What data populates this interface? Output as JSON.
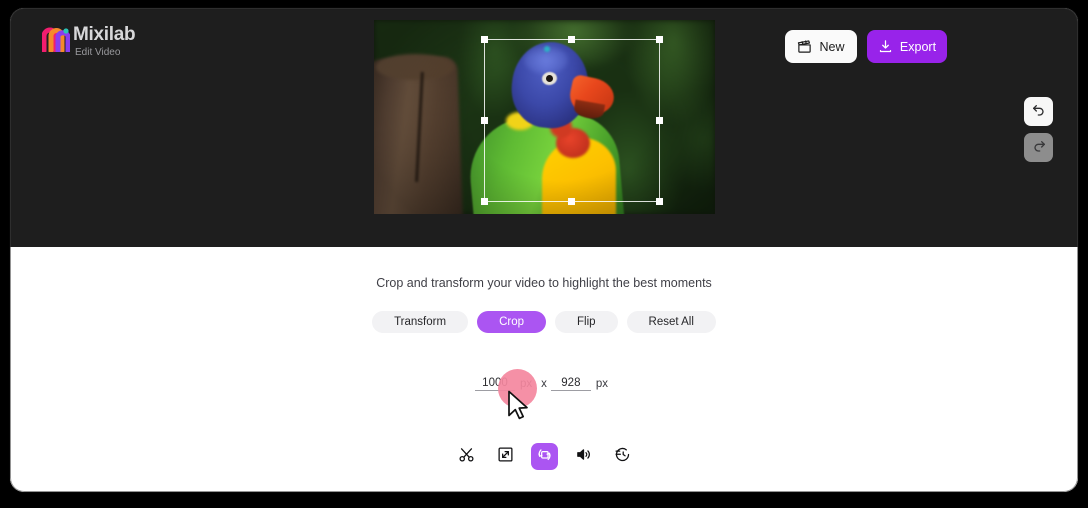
{
  "app": {
    "brand_name": "Mixilab",
    "brand_subtitle": "Edit Video",
    "accent_purple": "#ab55f2",
    "export_purple": "#9823ea",
    "header_bg": "#1e1e1e",
    "panel_bg": "#ffffff",
    "click_highlight_color": "#f4879e"
  },
  "header": {
    "new_label": "New",
    "new_icon": "clapperboard-icon",
    "export_label": "Export",
    "export_icon": "download-icon",
    "undo_icon": "undo-arrow-icon",
    "redo_icon": "redo-arrow-icon"
  },
  "preview": {
    "media_description": "rainbow lorikeet parrot perched on a wooden log",
    "crop_handles": 8
  },
  "main": {
    "hint": "Crop and transform your video to highlight the best moments",
    "tabs": [
      {
        "label": "Transform",
        "active": false
      },
      {
        "label": "Crop",
        "active": true
      },
      {
        "label": "Flip",
        "active": false
      },
      {
        "label": "Reset All",
        "active": false
      }
    ],
    "dimensions": {
      "width_value": "1000",
      "width_unit": "px",
      "separator": "x",
      "height_value": "928",
      "height_unit": "px"
    },
    "toolbar": [
      {
        "name": "cut-tool",
        "icon": "scissors-icon",
        "active": false
      },
      {
        "name": "resize-tool",
        "icon": "resize-diagonal-icon",
        "active": false
      },
      {
        "name": "transform-tool",
        "icon": "rotate-square-icon",
        "active": true
      },
      {
        "name": "volume-tool",
        "icon": "speaker-icon",
        "active": false
      },
      {
        "name": "history-tool",
        "icon": "clock-rewind-icon",
        "active": false
      }
    ]
  }
}
